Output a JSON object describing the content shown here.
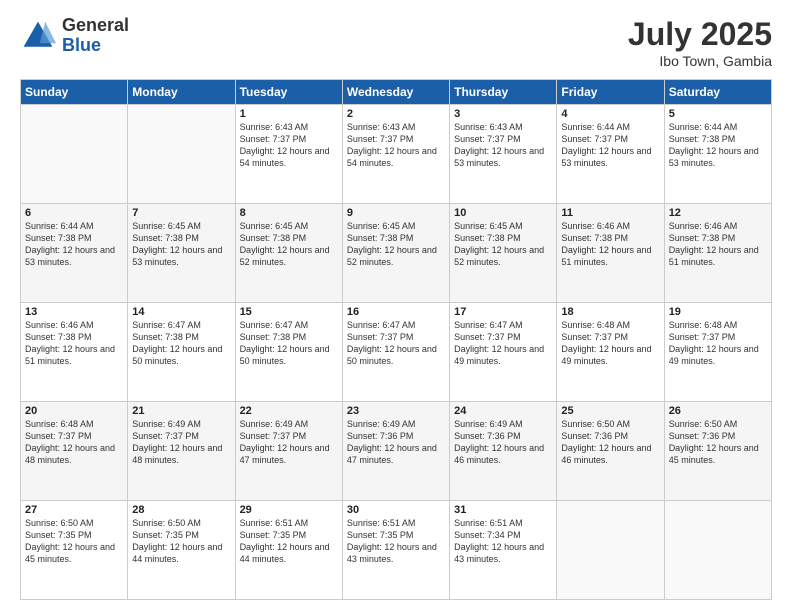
{
  "logo": {
    "general": "General",
    "blue": "Blue"
  },
  "title": {
    "month_year": "July 2025",
    "location": "Ibo Town, Gambia"
  },
  "days_of_week": [
    "Sunday",
    "Monday",
    "Tuesday",
    "Wednesday",
    "Thursday",
    "Friday",
    "Saturday"
  ],
  "weeks": [
    [
      {
        "day": "",
        "empty": true
      },
      {
        "day": "",
        "empty": true
      },
      {
        "day": "1",
        "sunrise": "6:43 AM",
        "sunset": "7:37 PM",
        "daylight": "12 hours and 54 minutes."
      },
      {
        "day": "2",
        "sunrise": "6:43 AM",
        "sunset": "7:37 PM",
        "daylight": "12 hours and 54 minutes."
      },
      {
        "day": "3",
        "sunrise": "6:43 AM",
        "sunset": "7:37 PM",
        "daylight": "12 hours and 53 minutes."
      },
      {
        "day": "4",
        "sunrise": "6:44 AM",
        "sunset": "7:37 PM",
        "daylight": "12 hours and 53 minutes."
      },
      {
        "day": "5",
        "sunrise": "6:44 AM",
        "sunset": "7:38 PM",
        "daylight": "12 hours and 53 minutes."
      }
    ],
    [
      {
        "day": "6",
        "sunrise": "6:44 AM",
        "sunset": "7:38 PM",
        "daylight": "12 hours and 53 minutes."
      },
      {
        "day": "7",
        "sunrise": "6:45 AM",
        "sunset": "7:38 PM",
        "daylight": "12 hours and 53 minutes."
      },
      {
        "day": "8",
        "sunrise": "6:45 AM",
        "sunset": "7:38 PM",
        "daylight": "12 hours and 52 minutes."
      },
      {
        "day": "9",
        "sunrise": "6:45 AM",
        "sunset": "7:38 PM",
        "daylight": "12 hours and 52 minutes."
      },
      {
        "day": "10",
        "sunrise": "6:45 AM",
        "sunset": "7:38 PM",
        "daylight": "12 hours and 52 minutes."
      },
      {
        "day": "11",
        "sunrise": "6:46 AM",
        "sunset": "7:38 PM",
        "daylight": "12 hours and 51 minutes."
      },
      {
        "day": "12",
        "sunrise": "6:46 AM",
        "sunset": "7:38 PM",
        "daylight": "12 hours and 51 minutes."
      }
    ],
    [
      {
        "day": "13",
        "sunrise": "6:46 AM",
        "sunset": "7:38 PM",
        "daylight": "12 hours and 51 minutes."
      },
      {
        "day": "14",
        "sunrise": "6:47 AM",
        "sunset": "7:38 PM",
        "daylight": "12 hours and 50 minutes."
      },
      {
        "day": "15",
        "sunrise": "6:47 AM",
        "sunset": "7:38 PM",
        "daylight": "12 hours and 50 minutes."
      },
      {
        "day": "16",
        "sunrise": "6:47 AM",
        "sunset": "7:37 PM",
        "daylight": "12 hours and 50 minutes."
      },
      {
        "day": "17",
        "sunrise": "6:47 AM",
        "sunset": "7:37 PM",
        "daylight": "12 hours and 49 minutes."
      },
      {
        "day": "18",
        "sunrise": "6:48 AM",
        "sunset": "7:37 PM",
        "daylight": "12 hours and 49 minutes."
      },
      {
        "day": "19",
        "sunrise": "6:48 AM",
        "sunset": "7:37 PM",
        "daylight": "12 hours and 49 minutes."
      }
    ],
    [
      {
        "day": "20",
        "sunrise": "6:48 AM",
        "sunset": "7:37 PM",
        "daylight": "12 hours and 48 minutes."
      },
      {
        "day": "21",
        "sunrise": "6:49 AM",
        "sunset": "7:37 PM",
        "daylight": "12 hours and 48 minutes."
      },
      {
        "day": "22",
        "sunrise": "6:49 AM",
        "sunset": "7:37 PM",
        "daylight": "12 hours and 47 minutes."
      },
      {
        "day": "23",
        "sunrise": "6:49 AM",
        "sunset": "7:36 PM",
        "daylight": "12 hours and 47 minutes."
      },
      {
        "day": "24",
        "sunrise": "6:49 AM",
        "sunset": "7:36 PM",
        "daylight": "12 hours and 46 minutes."
      },
      {
        "day": "25",
        "sunrise": "6:50 AM",
        "sunset": "7:36 PM",
        "daylight": "12 hours and 46 minutes."
      },
      {
        "day": "26",
        "sunrise": "6:50 AM",
        "sunset": "7:36 PM",
        "daylight": "12 hours and 45 minutes."
      }
    ],
    [
      {
        "day": "27",
        "sunrise": "6:50 AM",
        "sunset": "7:35 PM",
        "daylight": "12 hours and 45 minutes."
      },
      {
        "day": "28",
        "sunrise": "6:50 AM",
        "sunset": "7:35 PM",
        "daylight": "12 hours and 44 minutes."
      },
      {
        "day": "29",
        "sunrise": "6:51 AM",
        "sunset": "7:35 PM",
        "daylight": "12 hours and 44 minutes."
      },
      {
        "day": "30",
        "sunrise": "6:51 AM",
        "sunset": "7:35 PM",
        "daylight": "12 hours and 43 minutes."
      },
      {
        "day": "31",
        "sunrise": "6:51 AM",
        "sunset": "7:34 PM",
        "daylight": "12 hours and 43 minutes."
      },
      {
        "day": "",
        "empty": true
      },
      {
        "day": "",
        "empty": true
      }
    ]
  ]
}
